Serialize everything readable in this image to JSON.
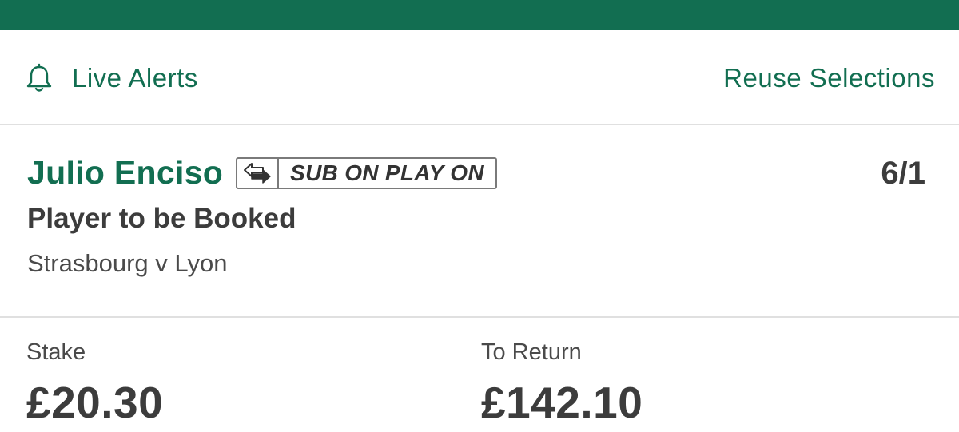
{
  "header": {
    "live_alerts_label": "Live Alerts",
    "live_alerts_icon": "bell-icon",
    "reuse_label": "Reuse Selections"
  },
  "selection": {
    "player": "Julio Enciso",
    "badge_icon": "substitution-arrows-icon",
    "badge_label": "SUB ON PLAY ON",
    "odds": "6/1",
    "market": "Player to be Booked",
    "event": "Strasbourg v Lyon"
  },
  "bet": {
    "stake_label": "Stake",
    "stake_value": "£20.30",
    "return_label": "To Return",
    "return_value": "£142.10"
  },
  "colors": {
    "brand_green": "#126e51",
    "text_dark": "#3c3c3c",
    "divider": "#e0e0e0"
  }
}
